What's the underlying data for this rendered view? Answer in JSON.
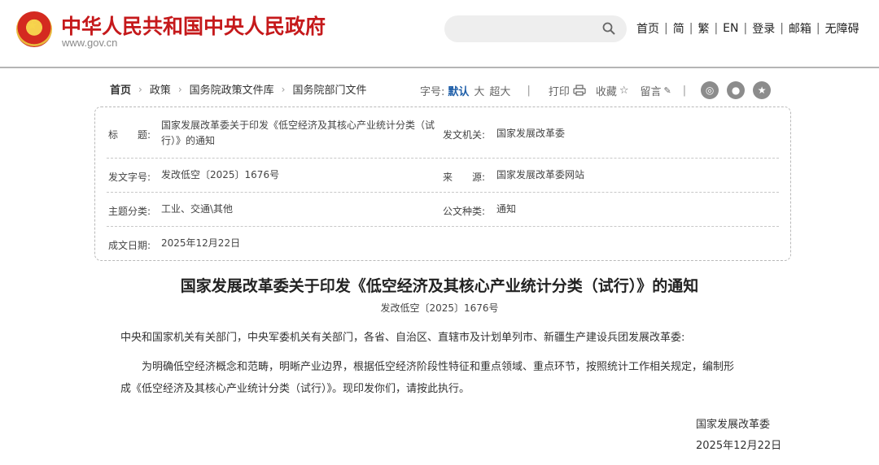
{
  "header": {
    "site_title": "中华人民共和国中央人民政府",
    "site_url": "www.gov.cn",
    "nav": [
      "首页",
      "简",
      "繁",
      "EN",
      "登录",
      "邮箱",
      "无障碍"
    ]
  },
  "breadcrumb": {
    "items": [
      "首页",
      "政策",
      "国务院政策文件库",
      "国务院部门文件"
    ],
    "font_label": "字号:",
    "font_default": "默认",
    "font_large": "大",
    "font_xlarge": "超大",
    "print": "打印",
    "favorite": "收藏",
    "comment": "留言"
  },
  "info": {
    "title_label": "标　　题:",
    "title_value": "国家发展改革委关于印发《低空经济及其核心产业统计分类（试行）》的通知",
    "issuer_label": "发文机关:",
    "issuer_value": "国家发展改革委",
    "docno_label": "发文字号:",
    "docno_value": "发改低空〔2025〕1676号",
    "source_label": "来　　源:",
    "source_value": "国家发展改革委网站",
    "topic_label": "主题分类:",
    "topic_value": "工业、交通\\其他",
    "type_label": "公文种类:",
    "type_value": "通知",
    "date_label": "成文日期:",
    "date_value": "2025年12月22日"
  },
  "article": {
    "title": "国家发展改革委关于印发《低空经济及其核心产业统计分类（试行）》的通知",
    "doc_no": "发改低空〔2025〕1676号",
    "salutation": "中央和国家机关有关部门，中央军委机关有关部门，各省、自治区、直辖市及计划单列市、新疆生产建设兵团发展改革委:",
    "body_line1": "为明确低空经济概念和范畴，明晰产业边界，根据低空经济阶段性特征和重点领域、重点环节，按照统计工作相关规定，编制形",
    "body_line2": "成《低空经济及其核心产业统计分类（试行）》。现印发你们，请按此执行。",
    "signer": "国家发展改革委",
    "date": "2025年12月22日"
  }
}
